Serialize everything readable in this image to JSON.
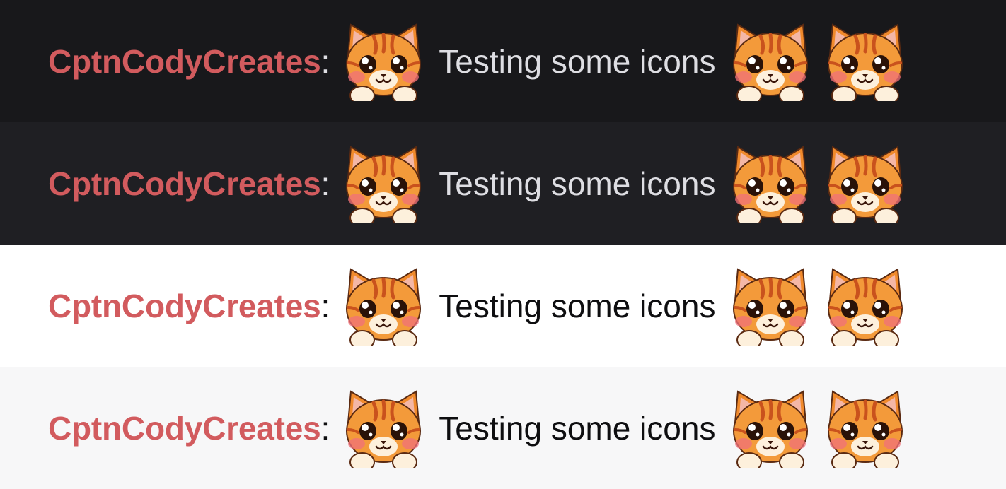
{
  "chat": {
    "rows": [
      {
        "theme": "dark",
        "username": "CptnCodyCreates",
        "separator": ":",
        "message": "Testing some icons",
        "emote": "cat-emote-icon"
      },
      {
        "theme": "dark",
        "username": "CptnCodyCreates",
        "separator": ":",
        "message": "Testing some icons",
        "emote": "cat-emote-icon"
      },
      {
        "theme": "light",
        "username": "CptnCodyCreates",
        "separator": ":",
        "message": "Testing some icons",
        "emote": "cat-emote-icon"
      },
      {
        "theme": "light",
        "username": "CptnCodyCreates",
        "separator": ":",
        "message": "Testing some icons",
        "emote": "cat-emote-icon"
      }
    ]
  },
  "colors": {
    "username": "#d25b5e",
    "dark_bg_1": "#18181b",
    "dark_bg_2": "#1f1f23",
    "light_bg_1": "#ffffff",
    "light_bg_2": "#f7f7f8",
    "dark_text": "#dedee3",
    "light_text": "#0e0e10"
  }
}
